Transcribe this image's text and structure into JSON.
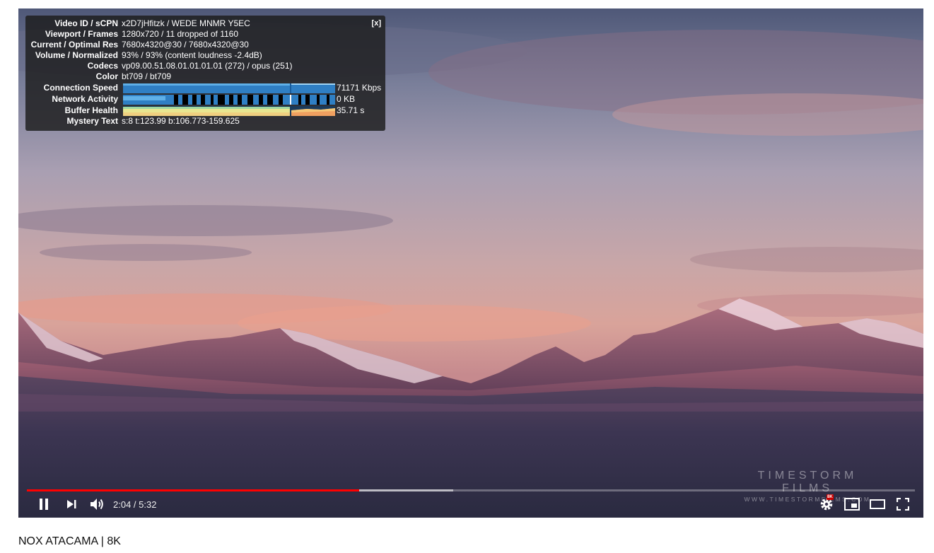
{
  "stats": {
    "close_label": "[x]",
    "rows": [
      {
        "label": "Video ID / sCPN",
        "value": "x2D7jHfitzk / WEDE MNMR Y5EC"
      },
      {
        "label": "Viewport / Frames",
        "value": "1280x720 / 11 dropped of 1160"
      },
      {
        "label": "Current / Optimal Res",
        "value": "7680x4320@30 / 7680x4320@30"
      },
      {
        "label": "Volume / Normalized",
        "value": "93% / 93% (content loudness -2.4dB)"
      },
      {
        "label": "Codecs",
        "value": "vp09.00.51.08.01.01.01.01 (272) / opus (251)"
      },
      {
        "label": "Color",
        "value": "bt709 / bt709"
      }
    ],
    "graphs": [
      {
        "label": "Connection Speed",
        "value": "71171 Kbps"
      },
      {
        "label": "Network Activity",
        "value": "0 KB"
      },
      {
        "label": "Buffer Health",
        "value": "35.71 s"
      }
    ],
    "mystery": {
      "label": "Mystery Text",
      "value": "s:8 t:123.99 b:106.773-159.625"
    }
  },
  "watermark": {
    "title": "TIMESTORM FILMS",
    "url": "WWW.TIMESTORMFILMS.COM"
  },
  "controls": {
    "time": "2:04 / 5:32",
    "played_fraction": 0.374,
    "loaded_fraction": 0.48,
    "quality_badge": "8K"
  },
  "video_title": "NOX ATACAMA | 8K",
  "colors": {
    "progress_played": "#ff0000",
    "badge": "#cc0000"
  }
}
